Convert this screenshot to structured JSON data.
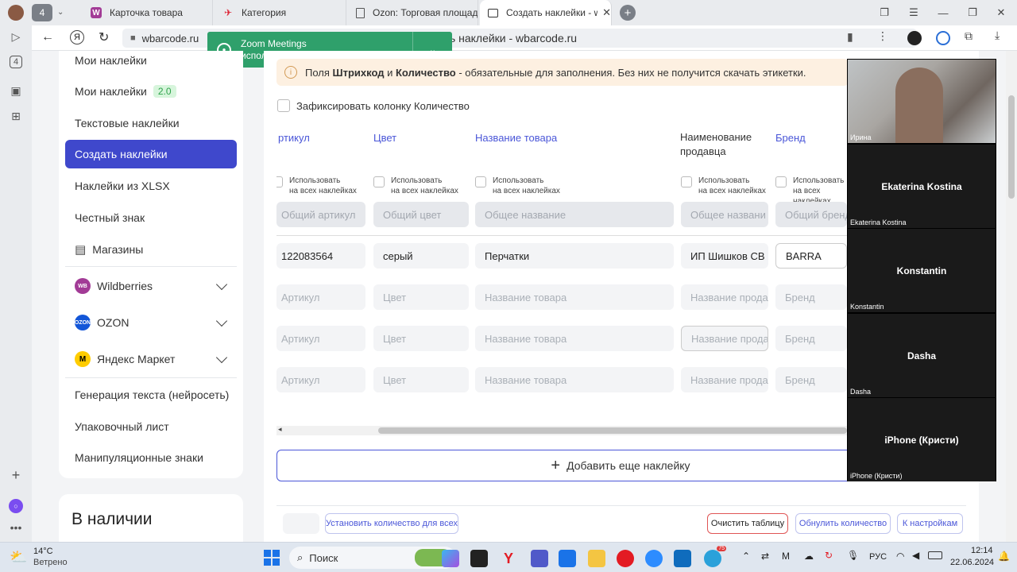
{
  "browser": {
    "tab_count": "4",
    "tabs": [
      {
        "title": "Карточка товара"
      },
      {
        "title": "Категория"
      },
      {
        "title": "Ozon: Торговая площадк"
      },
      {
        "title": "Создать наклейки - wb"
      }
    ],
    "url_domain": "wbarcode.ru",
    "page_title": "Создать наклейки - wbarcode.ru"
  },
  "zoom_popup": {
    "title": "Zoom Meetings",
    "subtitle": "использует веб-камеру"
  },
  "sidebar": {
    "items": [
      {
        "label": "Мои наклейки"
      },
      {
        "label": "Мои наклейки",
        "badge": "2.0"
      },
      {
        "label": "Текстовые наклейки"
      },
      {
        "label": "Создать наклейки"
      },
      {
        "label": "Наклейки из XLSX"
      },
      {
        "label": "Честный знак"
      },
      {
        "label": "Магазины"
      },
      {
        "label": "Wildberries"
      },
      {
        "label": "OZON"
      },
      {
        "label": "Яндекс Маркет"
      },
      {
        "label": "Генерация текста (нейросеть)"
      },
      {
        "label": "Упаковочный лист"
      },
      {
        "label": "Манипуляционные знаки"
      }
    ],
    "stock_heading": "В наличии"
  },
  "main": {
    "warning_prefix": "Поля ",
    "warning_b1": "Штрихкод",
    "warning_mid": " и ",
    "warning_b2": "Количество",
    "warning_suffix": " - обязательные для заполнения. Без них не получится скачать этикетки.",
    "fix_column_label": "Зафиксировать колонку Количество",
    "columns": [
      "ртикул",
      "Цвет",
      "Название товара",
      "Наименование продавца",
      "Бренд"
    ],
    "use_all_label_1": "Использовать",
    "use_all_label_2": "на всех наклейках",
    "common_placeholders": [
      "Общий артикул",
      "Общий цвет",
      "Общее название",
      "Общее названи",
      "Общий бренд"
    ],
    "row1": [
      "122083564",
      "серый",
      "Перчатки",
      "ИП Шишков СВ",
      "BARRA"
    ],
    "row_placeholders": [
      "Артикул",
      "Цвет",
      "Название товара",
      "Название прода",
      "Бренд"
    ],
    "add_sticker": "Добавить еще наклейку",
    "btn_set_qty": "Установить количество для всех",
    "btn_clear": "Очистить таблицу",
    "btn_reset_qty": "Обнулить количество",
    "btn_settings": "К настройкам"
  },
  "video": {
    "participants": [
      {
        "name": "",
        "label": "Ирина"
      },
      {
        "name": "Ekaterina Kostina",
        "label": "Ekaterina Kostina"
      },
      {
        "name": "Konstantin",
        "label": "Konstantin"
      },
      {
        "name": "Dasha",
        "label": "Dasha"
      },
      {
        "name": "iPhone (Кристи)",
        "label": "iPhone (Кристи)"
      }
    ]
  },
  "taskbar": {
    "weather_temp": "14°C",
    "weather_desc": "Ветрено",
    "search": "Поиск",
    "lang": "РУС",
    "time": "12:14",
    "date": "22.06.2024",
    "telegram_badge": "75"
  }
}
